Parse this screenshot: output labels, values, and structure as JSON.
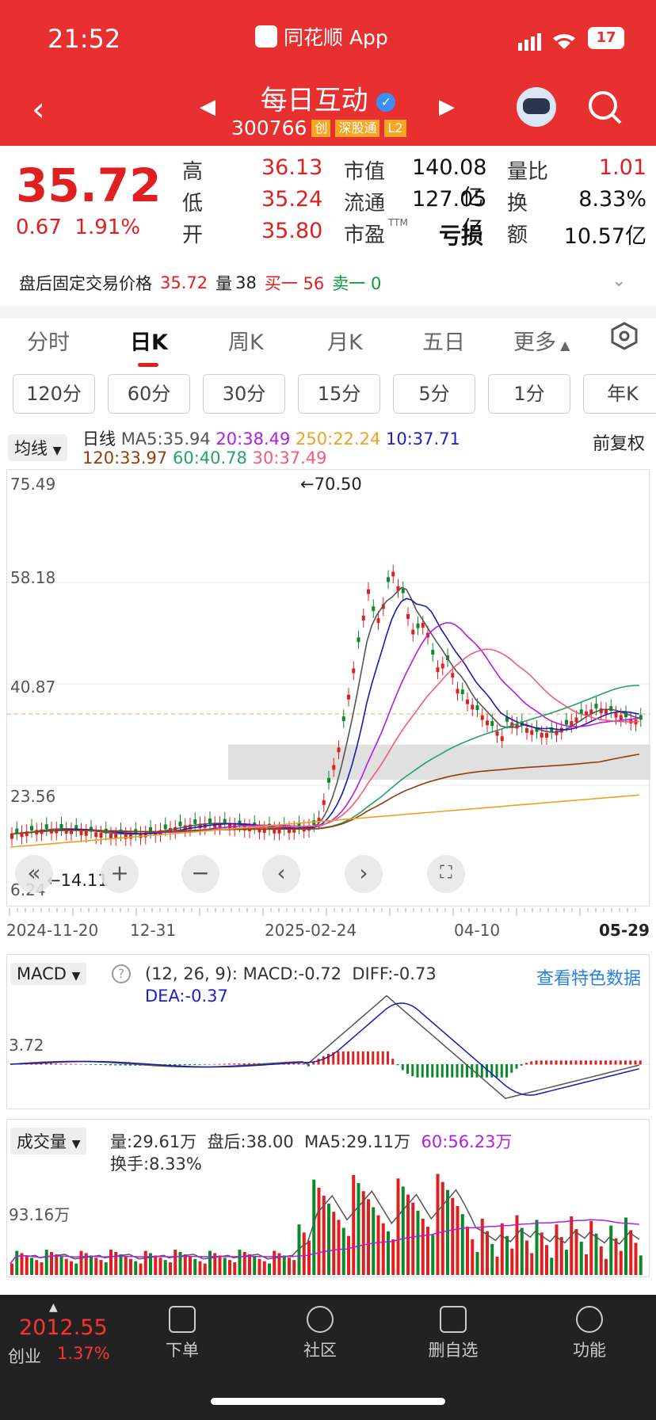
{
  "status": {
    "time": "21:52",
    "app_name": "同花顺 App",
    "battery": "17"
  },
  "header": {
    "title": "每日互动",
    "code": "300766",
    "tags": [
      "创",
      "深股通",
      "L2"
    ]
  },
  "quote": {
    "price": "35.72",
    "change": "0.67",
    "change_pct": "1.91%",
    "col1": [
      {
        "label": "高",
        "value": "36.13"
      },
      {
        "label": "低",
        "value": "35.24"
      },
      {
        "label": "开",
        "value": "35.80"
      }
    ],
    "col2": [
      {
        "label": "市值",
        "value": "140.08亿"
      },
      {
        "label": "流通",
        "value": "127.05亿"
      },
      {
        "label": "市盈",
        "sup": "TTM",
        "value": "亏损"
      }
    ],
    "col3": [
      {
        "label": "量比",
        "value": "1.01"
      },
      {
        "label": "换",
        "value": "8.33%"
      },
      {
        "label": "额",
        "value": "10.57亿"
      }
    ]
  },
  "after_market": {
    "label": "盘后固定交易价格",
    "price": "35.72",
    "vol_label": "量",
    "vol": "38",
    "buy1": "买一 56",
    "sell1": "卖一 0"
  },
  "tabs": [
    "分时",
    "日K",
    "周K",
    "月K",
    "五日",
    "更多"
  ],
  "active_tab": "日K",
  "periods": [
    "120分",
    "60分",
    "30分",
    "15分",
    "5分",
    "1分",
    "年K"
  ],
  "kline": {
    "indicator": "均线",
    "kind": "日线",
    "adjust": "前复权",
    "ma": {
      "ma5": "MA5:35.94",
      "ma20": "20:38.49",
      "ma250": "250:22.24",
      "ma10": "10:37.71",
      "ma120": "120:33.97",
      "ma60": "60:40.78",
      "ma30": "30:37.49"
    },
    "y_labels": [
      "75.49",
      "58.18",
      "40.87",
      "23.56",
      "6.24"
    ],
    "high_marker": "←70.50",
    "low_marker": "←14.11",
    "dates": [
      "2024-11-20",
      "12-31",
      "2025-02-24",
      "04-10",
      "05-29"
    ],
    "colors": {
      "up": "#e02020",
      "down": "#0a8a2a",
      "ma5": "#555555",
      "ma10": "#1a1ab0",
      "ma20": "#b21ee0",
      "ma30": "#f45a78",
      "ma60": "#21a36a",
      "ma120": "#9a3a0a",
      "ma250": "#f0a020"
    }
  },
  "macd": {
    "name": "MACD",
    "params": "(12, 26, 9):",
    "macd": "MACD:-0.72",
    "diff": "DIFF:-0.73",
    "dea": "DEA:-0.37",
    "link": "查看特色数据",
    "y_label": "3.72"
  },
  "volume": {
    "name": "成交量",
    "vol": "量:29.61万",
    "after": "盘后:38.00",
    "ma5": "MA5:29.11万",
    "ma60": "60:56.23万",
    "turnover": "换手:8.33%",
    "y_label": "93.16万"
  },
  "bottom": {
    "index_value": "2012.55",
    "index_name": "创业",
    "index_pct": "1.37%",
    "items": [
      "下单",
      "社区",
      "删自选",
      "功能"
    ]
  }
}
